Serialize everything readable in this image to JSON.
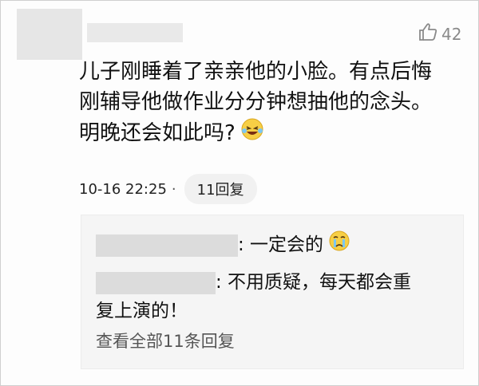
{
  "post": {
    "likes": "42",
    "comment_lines": [
      "儿子刚睡着了亲亲他的小脸。有点后悔",
      "刚辅导他做作业分分钟想抽他的念头。",
      "明晚还会如此吗?"
    ],
    "timestamp": "10-16 22:25",
    "separator": "·",
    "reply_count_label": "11回复"
  },
  "replies": {
    "items": [
      {
        "lines": [
          ": 一定会的"
        ]
      },
      {
        "lines": [
          ": 不用质疑，每天都会重",
          "复上演的！"
        ]
      }
    ],
    "view_all_label": "查看全部11条回复"
  },
  "icons": {
    "like": "thumbs-up-icon",
    "emoji_laugh": "laughing-tears-emoji-icon",
    "emoji_cry": "crying-emoji-icon"
  },
  "colors": {
    "reply_background": "#f5f5f5",
    "meta_text": "#222222",
    "muted": "#8a8a8a"
  }
}
